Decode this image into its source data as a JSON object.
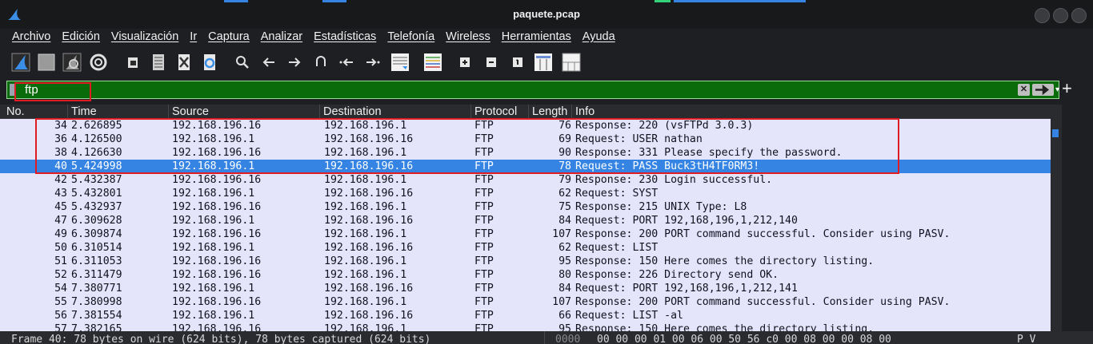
{
  "window": {
    "title": "paquete.pcap"
  },
  "menu": [
    {
      "label": "Archivo"
    },
    {
      "label": "Edición"
    },
    {
      "label": "Visualización"
    },
    {
      "label": "Ir"
    },
    {
      "label": "Captura"
    },
    {
      "label": "Analizar"
    },
    {
      "label": "Estadísticas"
    },
    {
      "label": "Telefonía"
    },
    {
      "label": "Wireless"
    },
    {
      "label": "Herramientas"
    },
    {
      "label": "Ayuda"
    }
  ],
  "toolbar": {
    "icons": [
      "start-capture-icon",
      "stop-capture-icon",
      "restart-capture-icon",
      "capture-options-icon",
      "open-file-icon",
      "save-file-icon",
      "close-file-icon",
      "reload-file-icon",
      "find-packet-icon",
      "go-back-icon",
      "go-forward-icon",
      "go-to-packet-icon",
      "go-first-packet-icon",
      "go-last-packet-icon",
      "autoscroll-icon",
      "colorize-icon",
      "zoom-in-icon",
      "zoom-out-icon",
      "normal-size-icon",
      "resize-columns-icon",
      "numbered-columns-icon"
    ]
  },
  "filter": {
    "value": "ftp",
    "clear_label": "✕",
    "dropdown_label": "▾",
    "add_label": "+"
  },
  "columns": {
    "no": "No.",
    "time": "Time",
    "source": "Source",
    "destination": "Destination",
    "protocol": "Protocol",
    "length": "Length",
    "info": "Info"
  },
  "packets": [
    {
      "no": "34",
      "time": "2.626895",
      "source": "192.168.196.16",
      "destination": "192.168.196.1",
      "protocol": "FTP",
      "length": "76",
      "info": "Response: 220 (vsFTPd 3.0.3)"
    },
    {
      "no": "36",
      "time": "4.126500",
      "source": "192.168.196.1",
      "destination": "192.168.196.16",
      "protocol": "FTP",
      "length": "69",
      "info": "Request: USER nathan"
    },
    {
      "no": "38",
      "time": "4.126630",
      "source": "192.168.196.16",
      "destination": "192.168.196.1",
      "protocol": "FTP",
      "length": "90",
      "info": "Response: 331 Please specify the password."
    },
    {
      "no": "40",
      "time": "5.424998",
      "source": "192.168.196.1",
      "destination": "192.168.196.16",
      "protocol": "FTP",
      "length": "78",
      "info": "Request: PASS Buck3tH4TF0RM3!"
    },
    {
      "no": "42",
      "time": "5.432387",
      "source": "192.168.196.16",
      "destination": "192.168.196.1",
      "protocol": "FTP",
      "length": "79",
      "info": "Response: 230 Login successful."
    },
    {
      "no": "43",
      "time": "5.432801",
      "source": "192.168.196.1",
      "destination": "192.168.196.16",
      "protocol": "FTP",
      "length": "62",
      "info": "Request: SYST"
    },
    {
      "no": "45",
      "time": "5.432937",
      "source": "192.168.196.16",
      "destination": "192.168.196.1",
      "protocol": "FTP",
      "length": "75",
      "info": "Response: 215 UNIX Type: L8"
    },
    {
      "no": "47",
      "time": "6.309628",
      "source": "192.168.196.1",
      "destination": "192.168.196.16",
      "protocol": "FTP",
      "length": "84",
      "info": "Request: PORT 192,168,196,1,212,140"
    },
    {
      "no": "49",
      "time": "6.309874",
      "source": "192.168.196.16",
      "destination": "192.168.196.1",
      "protocol": "FTP",
      "length": "107",
      "info": "Response: 200 PORT command successful. Consider using PASV."
    },
    {
      "no": "50",
      "time": "6.310514",
      "source": "192.168.196.1",
      "destination": "192.168.196.16",
      "protocol": "FTP",
      "length": "62",
      "info": "Request: LIST"
    },
    {
      "no": "51",
      "time": "6.311053",
      "source": "192.168.196.16",
      "destination": "192.168.196.1",
      "protocol": "FTP",
      "length": "95",
      "info": "Response: 150 Here comes the directory listing."
    },
    {
      "no": "52",
      "time": "6.311479",
      "source": "192.168.196.16",
      "destination": "192.168.196.1",
      "protocol": "FTP",
      "length": "80",
      "info": "Response: 226 Directory send OK."
    },
    {
      "no": "54",
      "time": "7.380771",
      "source": "192.168.196.1",
      "destination": "192.168.196.16",
      "protocol": "FTP",
      "length": "84",
      "info": "Request: PORT 192,168,196,1,212,141"
    },
    {
      "no": "55",
      "time": "7.380998",
      "source": "192.168.196.16",
      "destination": "192.168.196.1",
      "protocol": "FTP",
      "length": "107",
      "info": "Response: 200 PORT command successful. Consider using PASV."
    },
    {
      "no": "56",
      "time": "7.381554",
      "source": "192.168.196.1",
      "destination": "192.168.196.16",
      "protocol": "FTP",
      "length": "66",
      "info": "Request: LIST -al"
    },
    {
      "no": "57",
      "time": "7.382165",
      "source": "192.168.196.16",
      "destination": "192.168.196.1",
      "protocol": "FTP",
      "length": "95",
      "info": "Response: 150 Here comes the directory listing."
    }
  ],
  "selected_packet_no": "40",
  "detail": {
    "frame": "Frame 40: 78 bytes on wire (624 bits), 78 bytes captured (624 bits)",
    "offset": "0000",
    "hex": "00 00 00 01 00 06 00 50  56 c0 00 08 00 00 08 00",
    "ascii": "P V"
  },
  "colors": {
    "filter_bg": "#0a6b0a",
    "row_bg": "#e4e4fb",
    "selected_bg": "#3584e4",
    "highlight_box": "#e01b24"
  }
}
